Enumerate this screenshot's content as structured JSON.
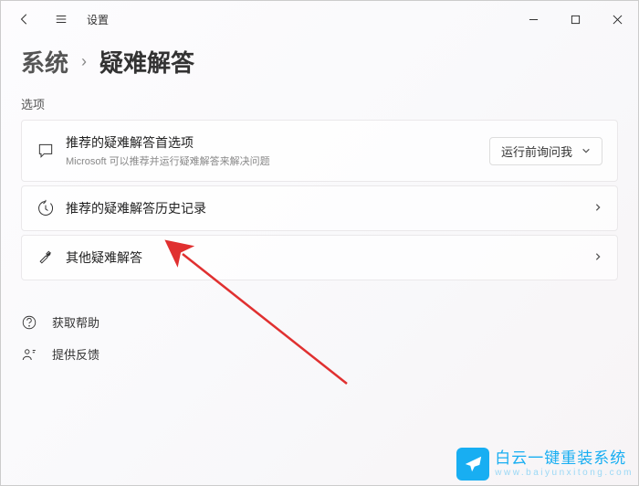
{
  "titlebar": {
    "title": "设置"
  },
  "breadcrumb": {
    "parent": "系统",
    "current": "疑难解答"
  },
  "section_label": "选项",
  "cards": {
    "recommended": {
      "title": "推荐的疑难解答首选项",
      "subtitle": "Microsoft 可以推荐并运行疑难解答来解决问题",
      "dropdown_value": "运行前询问我"
    },
    "history": {
      "title": "推荐的疑难解答历史记录"
    },
    "other": {
      "title": "其他疑难解答"
    }
  },
  "footer": {
    "help": "获取帮助",
    "feedback": "提供反馈"
  },
  "watermark": {
    "main": "白云一键重装系统",
    "sub": "www.baiyunxitong.com"
  }
}
